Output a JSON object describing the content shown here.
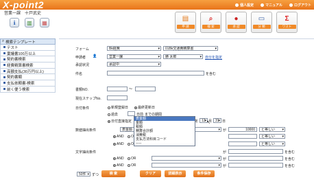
{
  "app": {
    "logo": "X-point2",
    "user": "営業一課　十戸武史"
  },
  "topright": {
    "link1": "個人設定",
    "link2": "マニュアル",
    "link3": "ログアウト"
  },
  "mainbuttons": [
    "申 請",
    "検 索",
    "承 認",
    "分 類",
    "ワスト"
  ],
  "sidebar": {
    "header": "検索テンプレート",
    "items": [
      "テスト",
      "稟議書100万以上",
      "契約書検索",
      "経費精算書検索",
      "高額支払(30万円以上)",
      "契約書類",
      "支払依頼書-検索",
      "前く便う検索"
    ]
  },
  "form": {
    "form_label": "フォーム",
    "form_value1": "Bk経費",
    "form_value2": "01Bk交通費精算書",
    "applicant_label": "申請者",
    "applicant_value1": "営業一課",
    "applicant_value2": "勝 太郎",
    "applicant_link": "自分を指定",
    "status_label": "承認状況",
    "status_value": "承認中",
    "subject_label": "件名",
    "subject_suffix": "を含む",
    "docno_label": "書類NO.",
    "docno_tilde": "～",
    "step_label": "現在ステップNo.",
    "date_label": "日付条件",
    "radio_new": "新規登録日",
    "radio_latest": "最終更新日",
    "radio_past": "過去",
    "past_value": "日前",
    "past_suffix": "までの期間",
    "radio_range": "日付直接指定",
    "range": {
      "y1": "2015",
      "l1": "年",
      "m1": "1",
      "l2": "月",
      "d1": "1",
      "l3": "日",
      "tilde": "～",
      "y2": "2015",
      "l4": "年",
      "m2": "12",
      "l5": "月",
      "d2": "31",
      "l6": "日"
    },
    "numcond_label": "数値抽出条件",
    "num_field": "表金額",
    "num_ga": "が",
    "num_value": "10000",
    "num_op": "と等しい",
    "and_label": "AND",
    "or_label": "OR",
    "op2": "と等しい",
    "op3": "と等しい",
    "textcond_label": "文字抽出条件",
    "text_suffix": "を含む",
    "text_ga": "が",
    "dropdown_items": [
      "表金額",
      "金額",
      "税額",
      "精算合計額",
      "消費税",
      "支払方法科目コード"
    ],
    "dropdown_tail": "-----"
  },
  "bottom": {
    "perpage": "50件",
    "perpage_suffix": "ずつ",
    "btn_search": "検 索",
    "btn_clear": "クリア",
    "btn_detail": "詳細表示",
    "btn_save": "条件保存"
  },
  "colors": {
    "orange": "#f08a28",
    "blue": "#3a62a6"
  }
}
